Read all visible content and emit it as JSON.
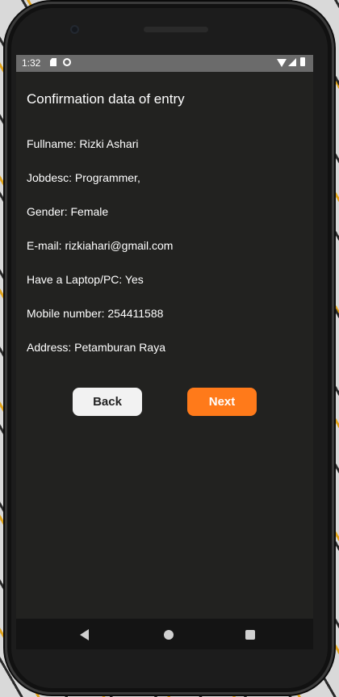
{
  "status_bar": {
    "time": "1:32"
  },
  "page": {
    "title": "Confirmation data of entry",
    "fields": [
      "Fullname: Rizki Ashari",
      "Jobdesc: Programmer,",
      "Gender: Female",
      "E-mail: rizkiahari@gmail.com",
      "Have a Laptop/PC: Yes",
      "Mobile number: 254411588",
      "Address: Petamburan Raya"
    ]
  },
  "buttons": {
    "back": "Back",
    "next": "Next"
  },
  "colors": {
    "background": "#222220",
    "accent": "#ff7a1a",
    "back_button": "#f2f2f2"
  },
  "icons": [
    "sd-card-icon",
    "sync-icon",
    "wifi-icon",
    "cell-signal-icon",
    "battery-icon",
    "nav-back-icon",
    "nav-home-icon",
    "nav-recents-icon"
  ]
}
